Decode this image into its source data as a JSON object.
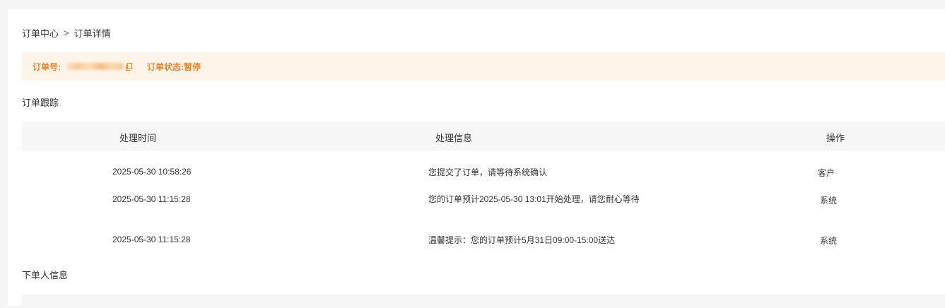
{
  "breadcrumb": {
    "parent": "订单中心",
    "separator": ">",
    "current": "订单详情"
  },
  "status": {
    "order_no_label": "订单号:",
    "order_state_label": "订单状态:",
    "order_state_value": "暂停",
    "text_color": "#e8862e",
    "bg_color": "#fff4e8"
  },
  "tracking": {
    "title": "订单跟踪",
    "columns": [
      "处理时间",
      "处理信息",
      "操作"
    ],
    "rows": [
      {
        "time": "2025-05-30 10:58:26",
        "info": "您提交了订单，请等待系统确认",
        "operator": "客户"
      },
      {
        "time": "2025-05-30 11:15:28",
        "info": "您的订单预计2025-05-30 13:01开始处理，请您耐心等待",
        "operator": "系统"
      },
      {
        "time": "2025-05-30 11:15:28",
        "info": "温馨提示：您的订单预计5月31日09:00-15:00送达",
        "operator": "系统"
      }
    ]
  },
  "orderer": {
    "title": "下单人信息"
  }
}
